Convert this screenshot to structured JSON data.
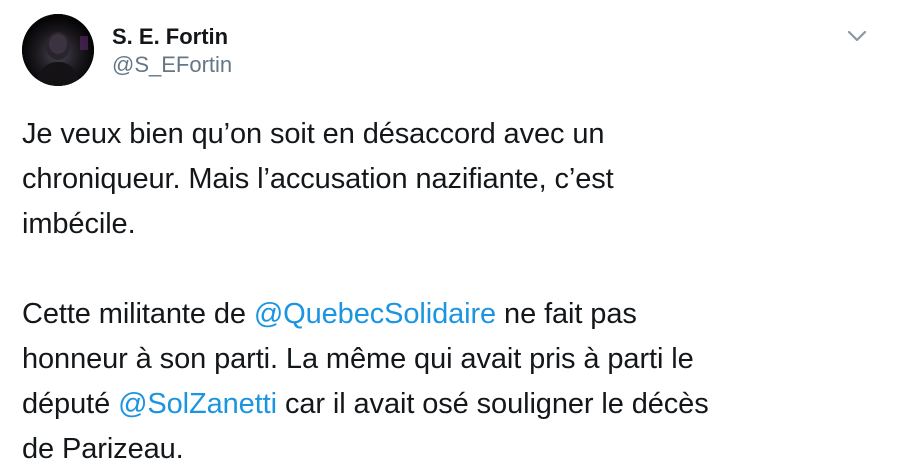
{
  "author": {
    "display_name": "S. E. Fortin",
    "handle": "@S_EFortin",
    "avatar_icon": "profile-photo"
  },
  "menu": {
    "icon": "chevron-down-icon"
  },
  "tweet": {
    "paragraph1": {
      "line1": "Je veux bien qu’on soit en désaccord avec un",
      "line2": "chroniqueur. Mais l’accusation nazifiante, c’est",
      "line3": "imbécile."
    },
    "paragraph2": {
      "part1": "Cette militante de ",
      "mention1": "@QuebecSolidaire",
      "part2": " ne fait pas",
      "line2": "honneur à son parti. La même qui avait pris à parti le",
      "part3": "député ",
      "mention2": "@SolZanetti",
      "part4": " car il avait osé souligner le décès",
      "line4": "de Parizeau."
    }
  },
  "colors": {
    "text": "#14171a",
    "secondary": "#657786",
    "link": "#1b95e0"
  }
}
